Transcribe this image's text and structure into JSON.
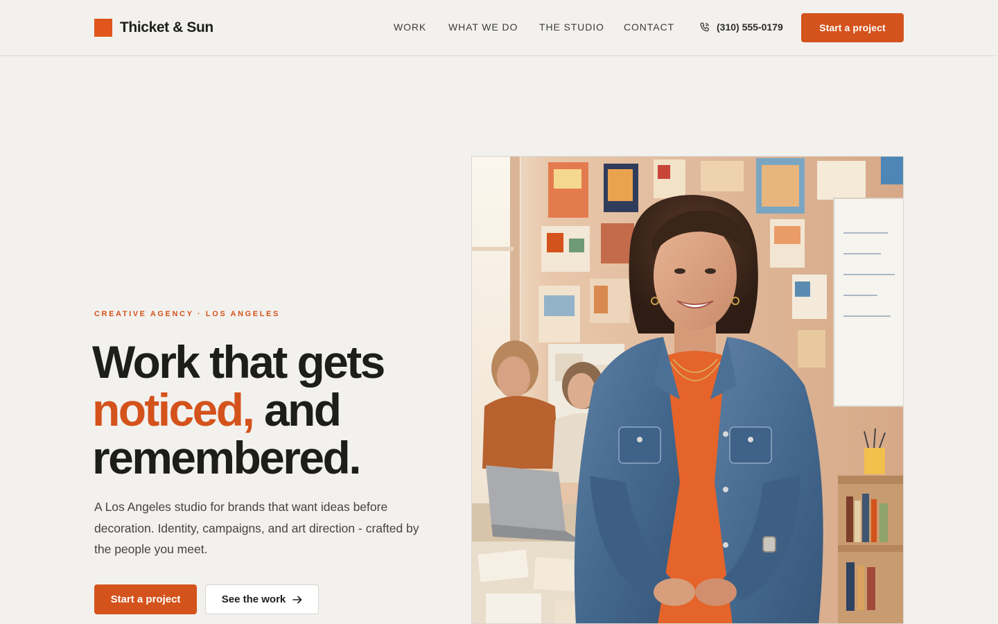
{
  "header": {
    "brand_name": "Thicket & Sun",
    "nav": {
      "work": "WORK",
      "what_we_do": "WHAT WE DO",
      "the_studio": "THE STUDIO",
      "contact": "CONTACT"
    },
    "phone": "(310) 555-0179",
    "cta_label": "Start a project"
  },
  "hero": {
    "eyebrow": "CREATIVE AGENCY · LOS ANGELES",
    "headline": {
      "line1": "Work that gets",
      "accent": "noticed,",
      "line2_rest": " and",
      "line3": "remembered."
    },
    "lede": "A Los Angeles studio for brands that want ideas before decoration. Identity, campaigns, and art direction - crafted by the people you meet.",
    "primary_cta": "Start a project",
    "secondary_cta": "See the work"
  },
  "icons": {
    "brand": "brand-square-icon",
    "phone": "phone-icon",
    "arrow": "arrow-right-icon"
  },
  "colors": {
    "accent": "#d4521b",
    "background": "#f2f1ee",
    "text": "#1d1d1b"
  }
}
